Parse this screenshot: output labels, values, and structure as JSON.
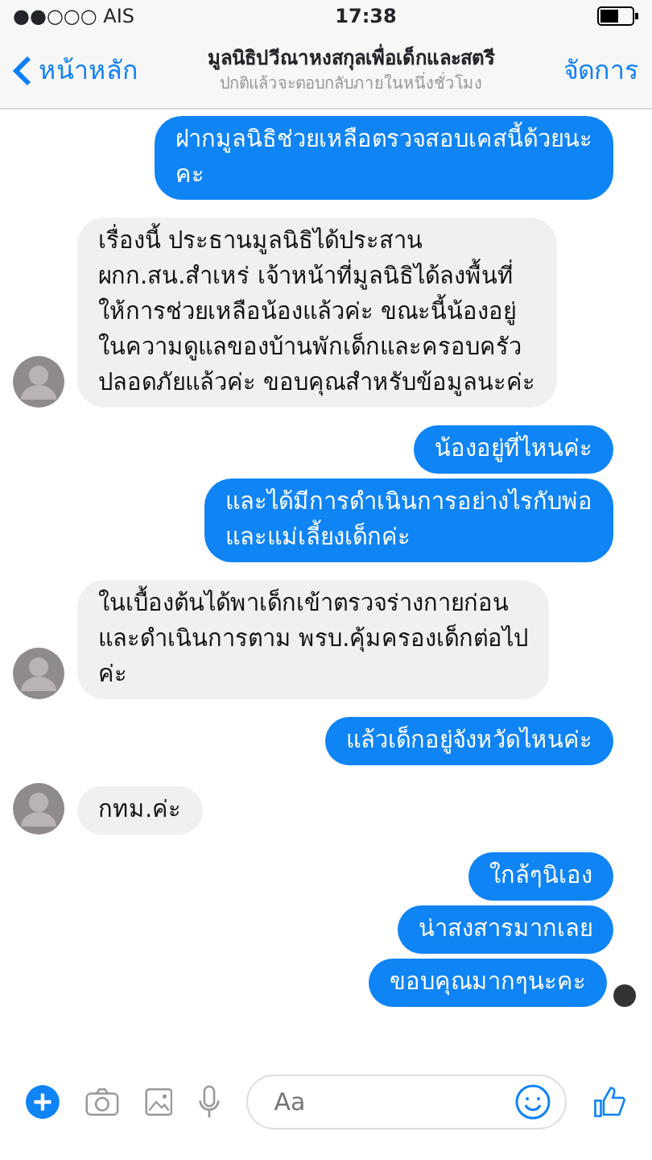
{
  "status_bar": {
    "carrier": "●●○○○ AIS",
    "time": "17:38"
  },
  "header": {
    "back": "หน้าหลัก",
    "title": "มูลนิธิปวีณาหงสกุลเพื่อเด็กและสตรี",
    "subtitle": "ปกติแล้วจะตอบกลับภายในหนึ่งชั่วโมง",
    "action": "จัดการ"
  },
  "messages": [
    {
      "kind": "outgoing",
      "text": "ฝากมูลนิธิช่วยเหลือตรวจสอบเคสนี้ด้วยนะ\nคะ"
    },
    {
      "kind": "incoming",
      "text": "เรื่องนี้ ประธานมูลนิธิได้ประสาน\nผกก.สน.สำเหร่ เจ้าหน้าที่มูลนิธิได้ลงพื้นที่\nให้การช่วยเหลือน้องแล้วค่ะ ขณะนี้น้องอยู่\nในความดูแลของบ้านพักเด็กและครอบครัว\nปลอดภัยแล้วค่ะ ขอบคุณสำหรับข้อมูลนะค่ะ"
    },
    {
      "kind": "outgoing",
      "text": "น้องอยู่ที่ไหนค่ะ"
    },
    {
      "kind": "outgoing",
      "text": "และได้มีการดำเนินการอย่างไรกับพ่อ\nและแม่เลี้ยงเด็กค่ะ"
    },
    {
      "kind": "incoming",
      "text": "ในเบื้องต้นได้พาเด็กเข้าตรวจร่างกายก่อน\nและดำเนินการตาม พรบ.คุ้มครองเด็กต่อไป\nค่ะ"
    },
    {
      "kind": "outgoing",
      "text": "แล้วเด็กอยู่จังหวัดไหนค่ะ"
    },
    {
      "kind": "incoming",
      "text": "กทม.ค่ะ"
    },
    {
      "kind": "outgoing",
      "text": "ใกล้ๆนิเอง"
    },
    {
      "kind": "outgoing",
      "text": "น่าสงสารมากเลย"
    },
    {
      "kind": "outgoing",
      "text": "ขอบคุณมากๆนะคะ"
    }
  ],
  "composer": {
    "placeholder": "Aa"
  }
}
